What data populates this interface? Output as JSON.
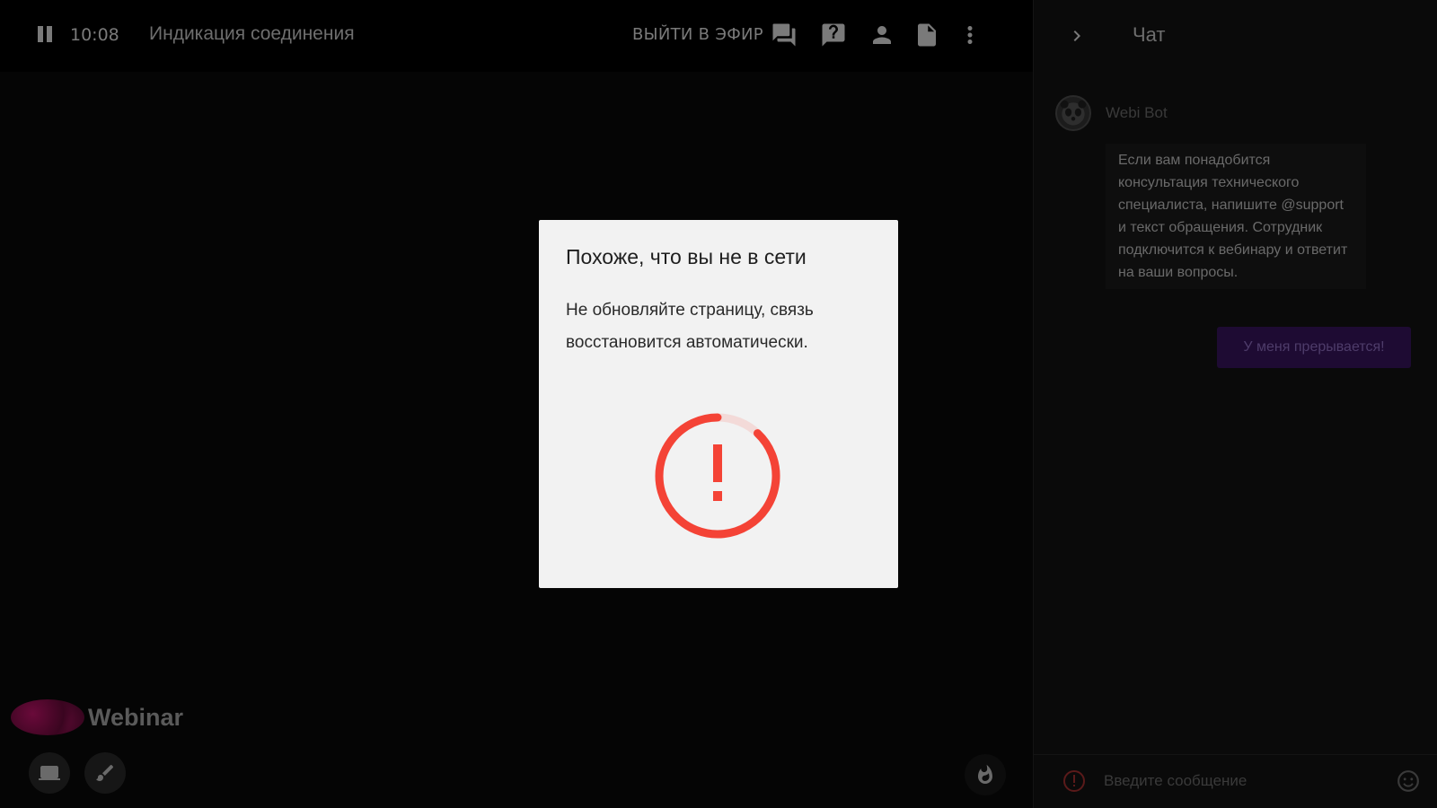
{
  "topbar": {
    "time": "10:08",
    "title": "Индикация соединения",
    "go_live_label": "ВЫЙТИ В ЭФИР",
    "icons": [
      "pause-icon",
      "chat-bubbles-icon",
      "question-icon",
      "person-icon",
      "document-icon",
      "more-vert-icon"
    ]
  },
  "brand": {
    "logo_text": "Webinar"
  },
  "bottom_controls": {
    "icons": [
      "monitor-icon",
      "brush-icon",
      "fire-icon"
    ]
  },
  "modal": {
    "title": "Похоже, что вы не в сети",
    "message": "Не обновляйте страницу, связь восстановится автоматически.",
    "icon": "error-ring-icon",
    "accent_color": "#f44336"
  },
  "chat": {
    "title": "Чат",
    "messages": [
      {
        "author": "Webi Bot",
        "text": "Если вам понадобится консультация технического специалиста, напишите @support и текст обращения. Сотрудник подключится к вебинару и ответит на ваши вопросы."
      }
    ],
    "quick_reply_label": "У меня прерывается!",
    "input_placeholder": "Введите сообщение",
    "accent_color": "#5b2a9e"
  }
}
